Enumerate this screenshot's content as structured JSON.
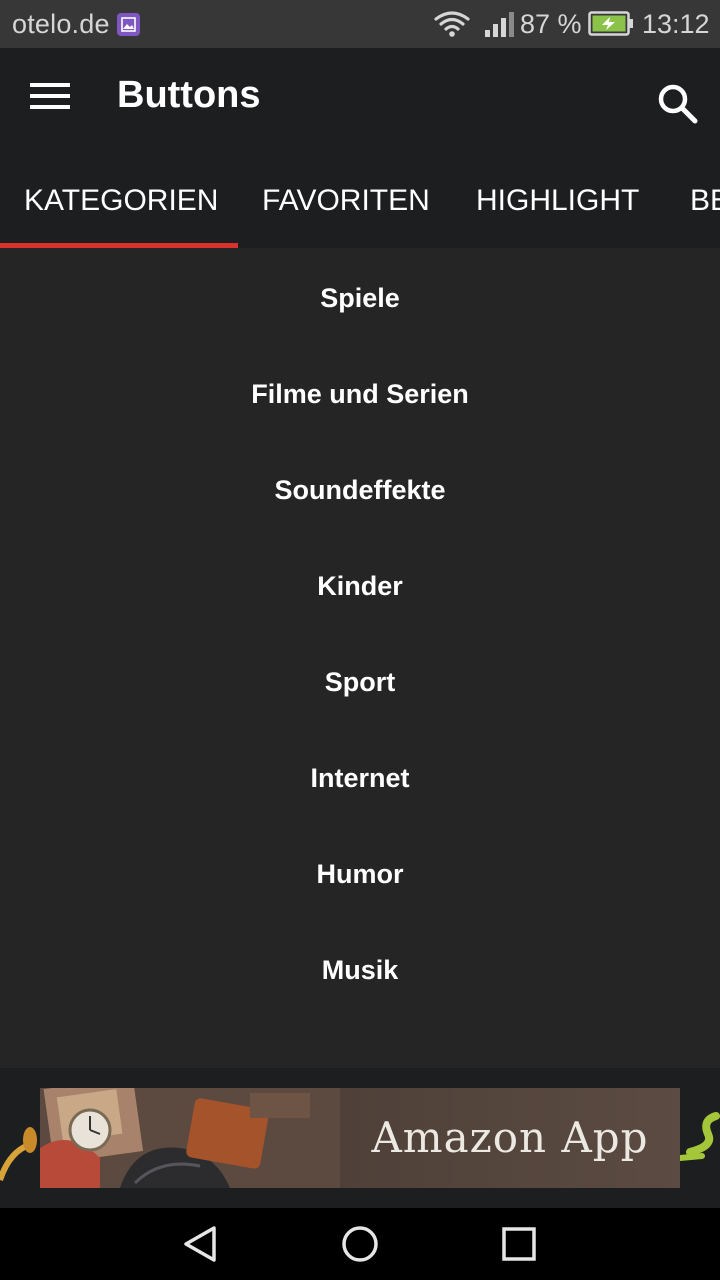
{
  "status_bar": {
    "carrier": "otelo.de",
    "battery_percent": "87 %",
    "time": "13:12",
    "icons": [
      "image-notification-icon",
      "wifi-icon",
      "cell-signal-icon",
      "battery-charging-icon"
    ]
  },
  "app_bar": {
    "title": "Buttons",
    "icons": [
      "menu-icon",
      "search-icon"
    ]
  },
  "tabs": [
    {
      "label": "KATEGORIEN",
      "selected": true
    },
    {
      "label": "FAVORITEN",
      "selected": false
    },
    {
      "label": "HIGHLIGHT",
      "selected": false
    },
    {
      "label": "BE",
      "selected": false
    }
  ],
  "categories": [
    "Spiele",
    "Filme und Serien",
    "Soundeffekte",
    "Kinder",
    "Sport",
    "Internet",
    "Humor",
    "Musik"
  ],
  "ad": {
    "text": "Amazon App"
  },
  "nav_bar": {
    "icons": [
      "back-icon",
      "home-icon",
      "recents-icon"
    ]
  },
  "colors": {
    "accent": "#d8322f",
    "app_bar": "#1d1e20",
    "list_background": "#252525",
    "status_bar": "#373737",
    "battery_fill": "#8bc34a",
    "app_badge": "#7e57c2"
  }
}
